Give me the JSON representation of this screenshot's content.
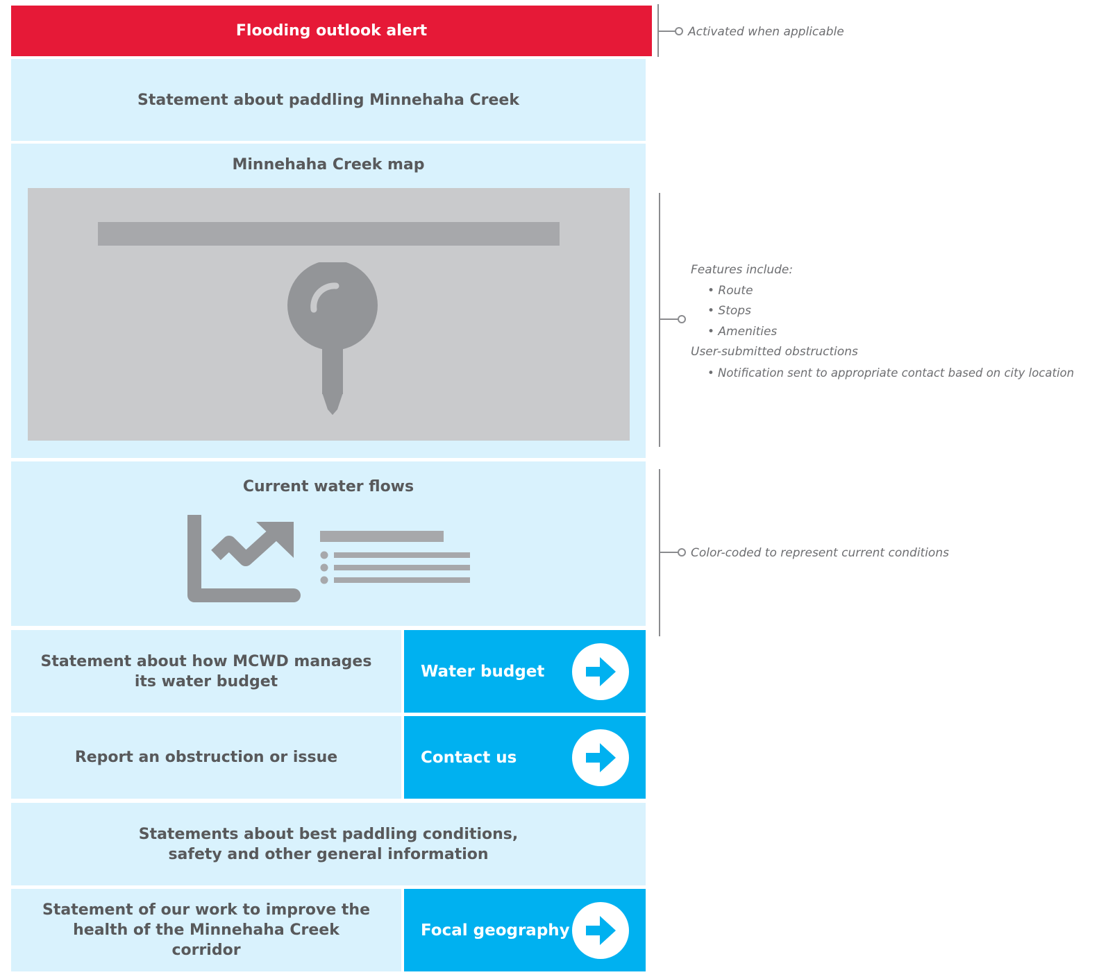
{
  "alert": {
    "label": "Flooding outlook alert"
  },
  "intro": {
    "text": "Statement about paddling Minnehaha Creek"
  },
  "map_section": {
    "title": "Minnehaha Creek map"
  },
  "flows_section": {
    "title": "Current water flows"
  },
  "rows": [
    {
      "text": "Statement about how MCWD manages its water budget",
      "cta": "Water budget"
    },
    {
      "text": "Report an obstruction or issue",
      "cta": "Contact us"
    },
    {
      "text": "Statements about best paddling conditions, safety and other general information"
    },
    {
      "text": "Statement of our work to improve the health of the Minnehaha Creek corridor",
      "cta": "Focal geography"
    }
  ],
  "annotations": {
    "alert": "Activated when applicable",
    "map": {
      "heading": "Features include:",
      "items": [
        "• Route",
        "• Stops",
        "• Amenities"
      ],
      "subheading": "User-submitted obstructions",
      "subitems": [
        "• Notification sent to appropriate contact based on city location"
      ]
    },
    "flows": "Color-coded to represent current conditions"
  },
  "colors": {
    "alert_red": "#e61937",
    "panel_light_blue": "#d9f2fd",
    "cta_blue": "#00b1f0",
    "placeholder_gray": "#c9cacc",
    "icon_gray": "#939598",
    "text_gray": "#58595b"
  },
  "icons": [
    "map-pin-icon",
    "trend-chart-icon",
    "arrow-right-icon"
  ]
}
